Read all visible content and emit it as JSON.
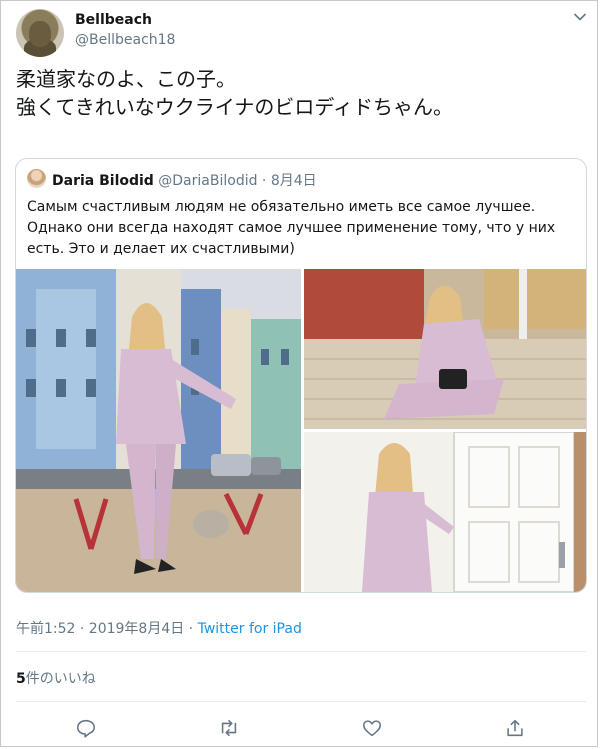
{
  "author": {
    "name": "Bellbeach",
    "handle": "@Bellbeach18"
  },
  "tweet": {
    "text": "柔道家なのよ、この子。\n強くてきれいなウクライナのビロディドちゃん。"
  },
  "quoted": {
    "name": "Daria Bilodid",
    "handle": "@DariaBilodid",
    "separator": " · ",
    "date": "8月4日",
    "text": "Самым счастливым людям не обязательно иметь все самое лучшее. Однако они всегда находят самое лучшее применение тому, что у них есть. Это и делает их счастливыми)"
  },
  "meta": {
    "timestamp": "午前1:52 · 2019年8月4日 · ",
    "source": "Twitter for iPad"
  },
  "likes": {
    "count": "5",
    "label": "件のいいね"
  },
  "actions": [
    "reply-icon",
    "retweet-icon",
    "like-icon",
    "share-icon"
  ],
  "colors": {
    "link": "#1b95e0",
    "secondary_text": "#657786",
    "primary_text": "#14171a",
    "divider": "#e6ecf0",
    "icon": "#657786"
  }
}
